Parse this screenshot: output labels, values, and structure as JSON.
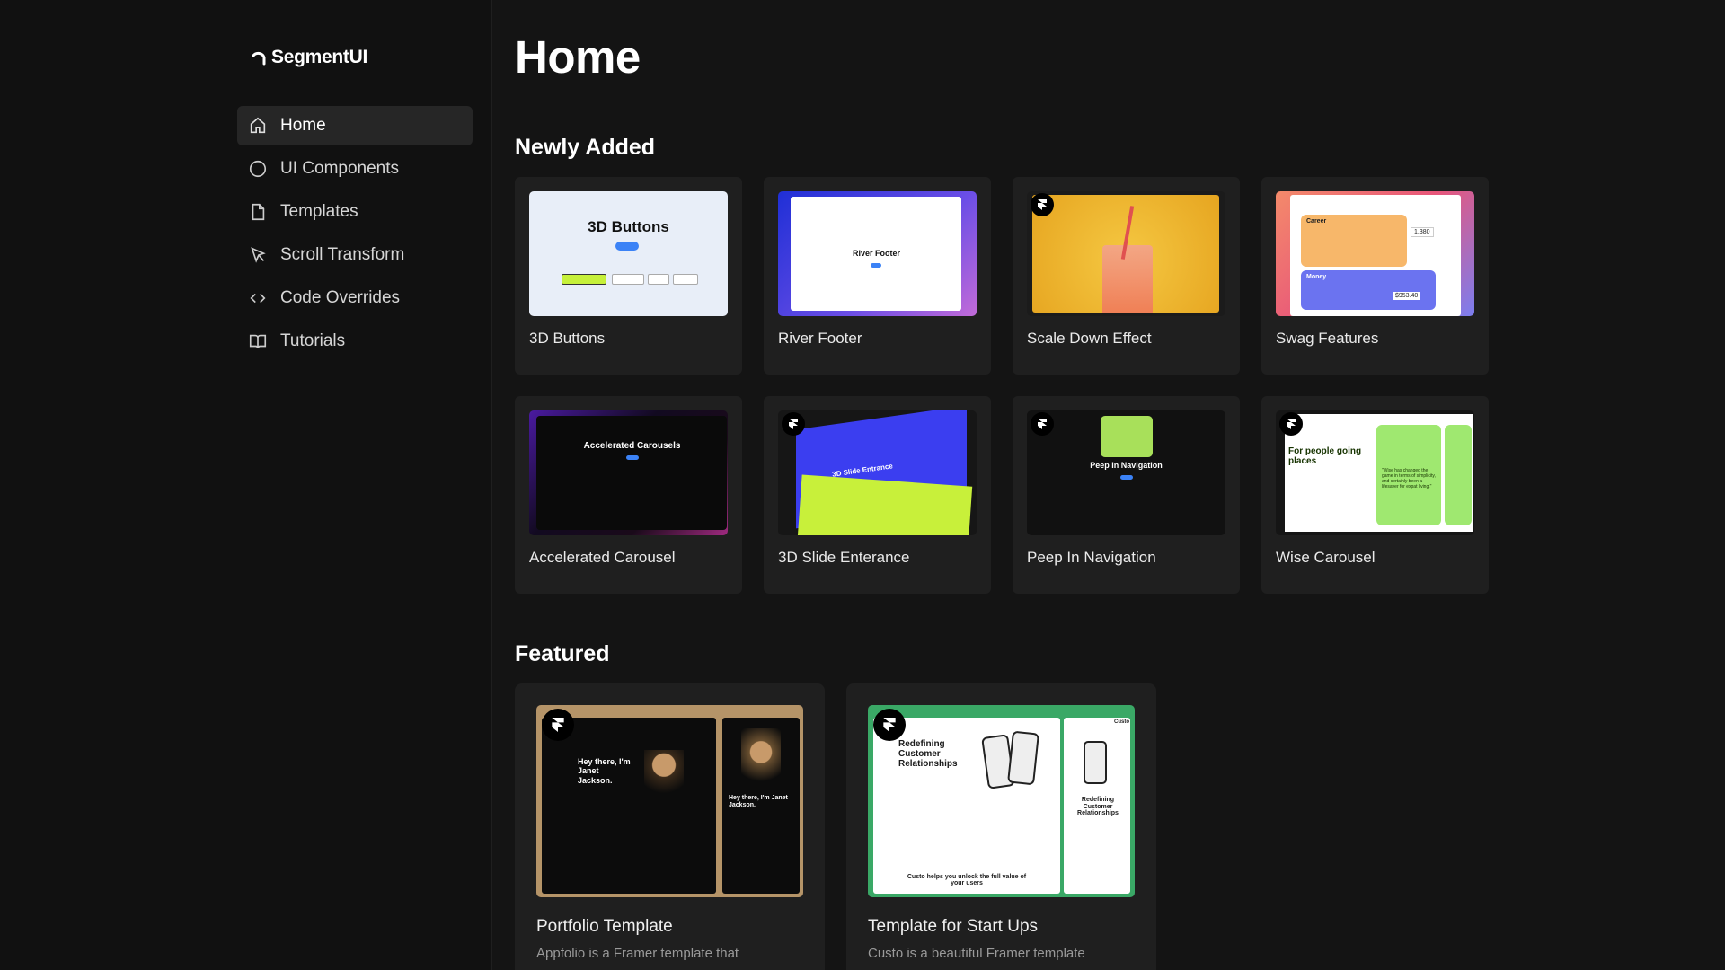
{
  "app": {
    "name": "SegmentUI"
  },
  "sidebar": {
    "items": [
      {
        "label": "Home",
        "icon": "home-icon",
        "active": true
      },
      {
        "label": "UI Components",
        "icon": "circle-icon"
      },
      {
        "label": "Templates",
        "icon": "file-icon"
      },
      {
        "label": "Scroll Transform",
        "icon": "cursor-icon"
      },
      {
        "label": "Code Overrides",
        "icon": "code-icon"
      },
      {
        "label": "Tutorials",
        "icon": "book-icon"
      }
    ]
  },
  "page": {
    "title": "Home"
  },
  "newly_added": {
    "title": "Newly Added",
    "items": [
      {
        "label": "3D Buttons",
        "thumb_title": "3D Buttons"
      },
      {
        "label": "River Footer",
        "thumb_title": "River Footer"
      },
      {
        "label": "Scale Down Effect"
      },
      {
        "label": "Swag Features",
        "thumb_career": "Career",
        "thumb_money": "Money",
        "thumb_num1": "1,380",
        "thumb_num2": "$953.40"
      },
      {
        "label": "Accelerated Carousel",
        "thumb_title": "Accelerated Carousels"
      },
      {
        "label": "3D Slide Enterance",
        "thumb_title": "3D Slide Entrance"
      },
      {
        "label": "Peep In Navigation",
        "thumb_title": "Peep in Navigation"
      },
      {
        "label": "Wise Carousel",
        "thumb_title": "For people going places",
        "thumb_quote": "\"Wise has changed the game in terms of simplicity, and certainly been a lifesaver for expat living.\""
      }
    ]
  },
  "featured": {
    "title": "Featured",
    "items": [
      {
        "title": "Portfolio Template",
        "desc": "Appfolio is a Framer template that",
        "thumb_heading": "Hey there, I'm Janet Jackson.",
        "thumb_heading2": "Hey there, I'm Janet Jackson."
      },
      {
        "title": "Template for Start Ups",
        "desc": "Custo is a beautiful Framer template",
        "thumb_heading": "Redefining Customer Relationships",
        "thumb_sub": "Custo helps you unlock the full value of your users",
        "thumb_heading2": "Redefining Customer Relationships",
        "thumb_brand": "Custo"
      }
    ]
  },
  "colors": {
    "background": "#141414",
    "sidebar": "#111111",
    "card": "#1f1f1f",
    "active_nav": "#262626"
  }
}
